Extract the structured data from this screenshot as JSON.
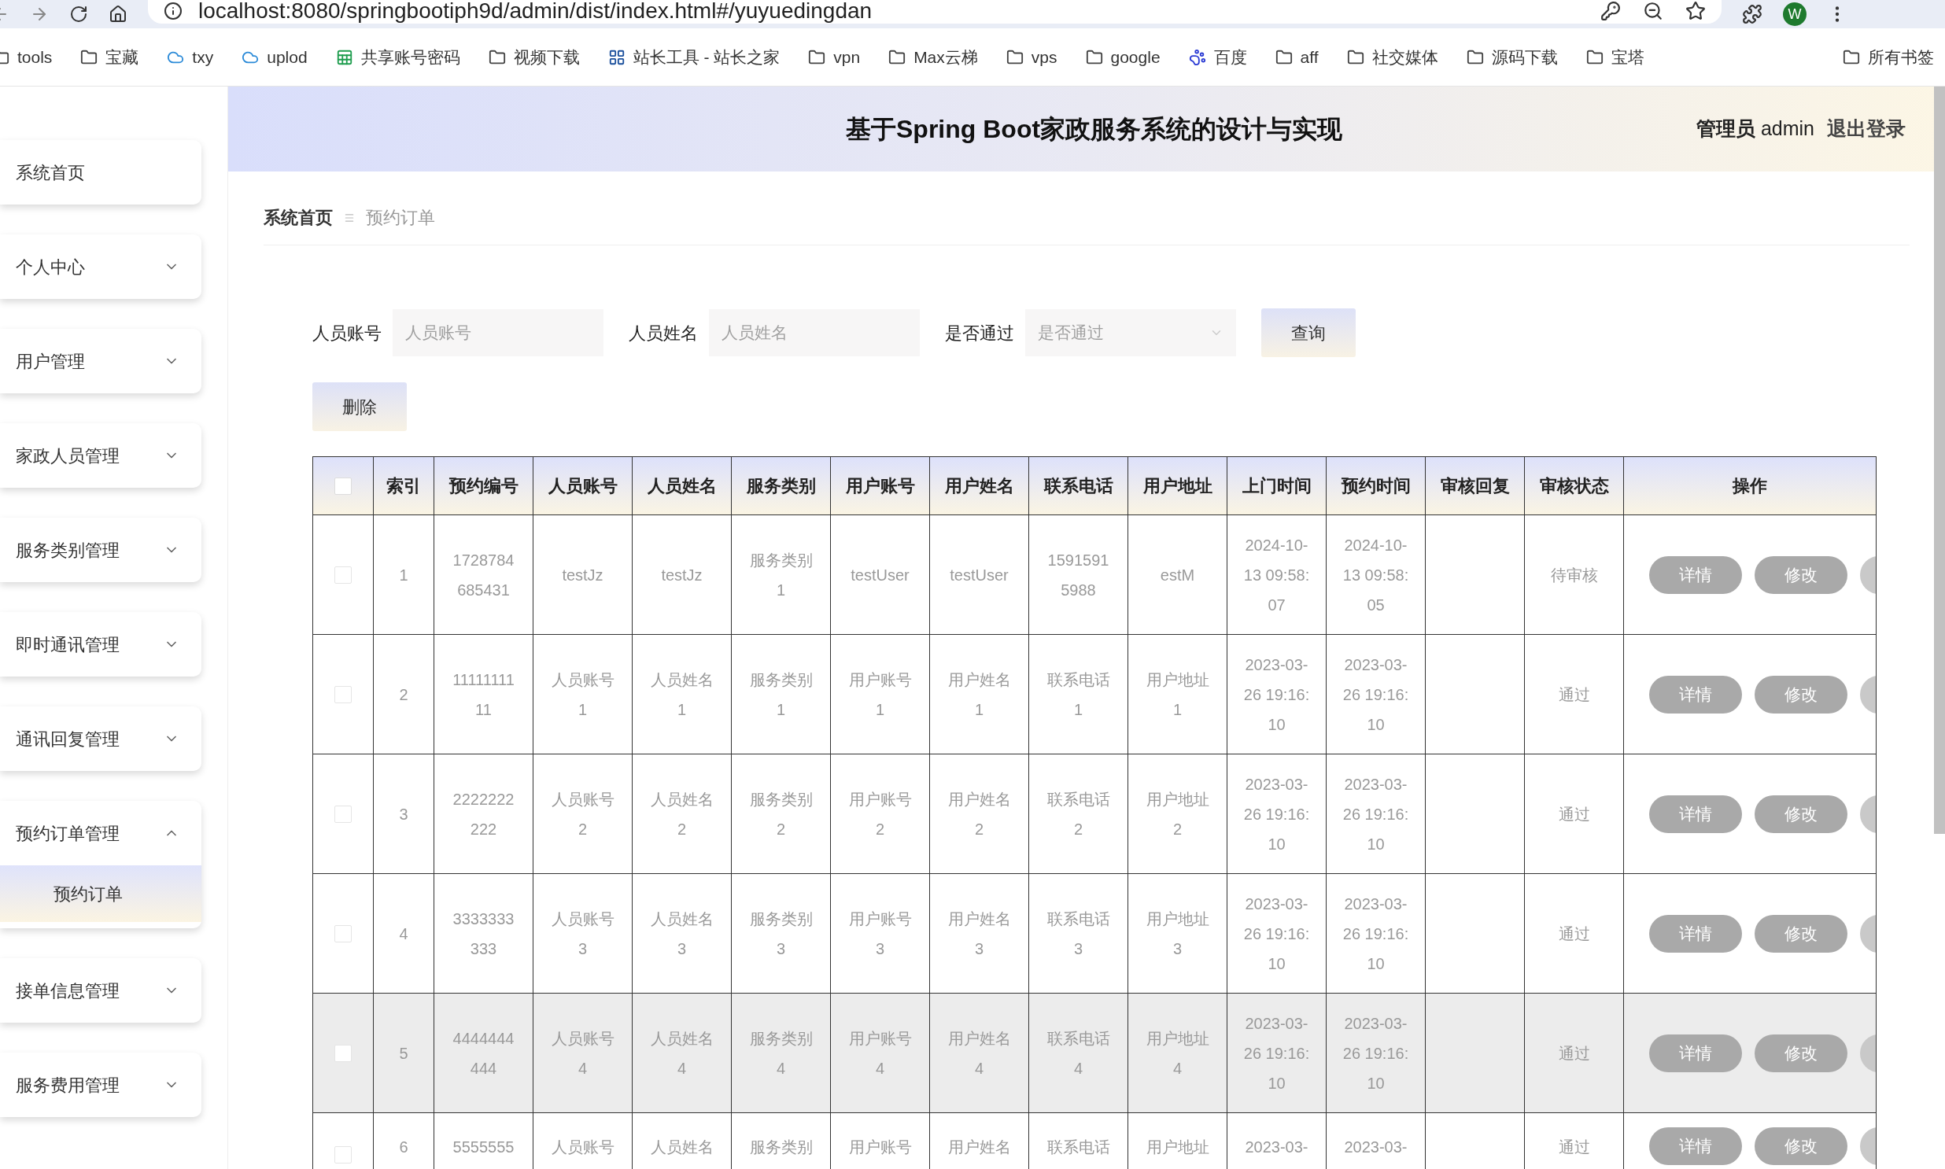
{
  "browser": {
    "url": "localhost:8080/springbootiph9d/admin/dist/index.html#/yuyuedingdan",
    "profile_initial": "W",
    "bookmarks": [
      {
        "label": "tools",
        "kind": "folder"
      },
      {
        "label": "宝藏",
        "kind": "folder"
      },
      {
        "label": "txy",
        "kind": "cloud"
      },
      {
        "label": "uplod",
        "kind": "cloud"
      },
      {
        "label": "共享账号密码",
        "kind": "sheet"
      },
      {
        "label": "视频下载",
        "kind": "folder"
      },
      {
        "label": "站长工具 - 站长之家",
        "kind": "site"
      },
      {
        "label": "vpn",
        "kind": "folder"
      },
      {
        "label": "Max云梯",
        "kind": "folder"
      },
      {
        "label": "vps",
        "kind": "folder"
      },
      {
        "label": "google",
        "kind": "folder"
      },
      {
        "label": "百度",
        "kind": "paw"
      },
      {
        "label": "aff",
        "kind": "folder"
      },
      {
        "label": "社交媒体",
        "kind": "folder"
      },
      {
        "label": "源码下载",
        "kind": "folder"
      },
      {
        "label": "宝塔",
        "kind": "folder"
      },
      {
        "label": "所有书签",
        "kind": "folder"
      }
    ]
  },
  "header": {
    "title": "基于Spring Boot家政服务系统的设计与实现",
    "user_role": "管理员",
    "user_name": "admin",
    "logout": "退出登录"
  },
  "sidebar": {
    "items": [
      {
        "label": "系统首页"
      },
      {
        "label": "个人中心",
        "expanded": false
      },
      {
        "label": "用户管理",
        "expanded": false
      },
      {
        "label": "家政人员管理",
        "expanded": false
      },
      {
        "label": "服务类别管理",
        "expanded": false
      },
      {
        "label": "即时通讯管理",
        "expanded": false
      },
      {
        "label": "通讯回复管理",
        "expanded": false
      },
      {
        "label": "预约订单管理",
        "expanded": true,
        "children": [
          {
            "label": "预约订单",
            "selected": true
          }
        ]
      },
      {
        "label": "接单信息管理",
        "expanded": false
      },
      {
        "label": "服务费用管理",
        "expanded": false
      }
    ]
  },
  "breadcrumb": [
    "系统首页",
    "预约订单"
  ],
  "search": {
    "fields": [
      {
        "label": "人员账号",
        "placeholder": "人员账号",
        "kind": "text"
      },
      {
        "label": "人员姓名",
        "placeholder": "人员姓名",
        "kind": "text"
      },
      {
        "label": "是否通过",
        "placeholder": "是否通过",
        "kind": "select"
      }
    ],
    "button": "查询"
  },
  "delete_button": "删除",
  "table": {
    "header_checked": false,
    "columns": [
      {
        "label": "索引",
        "kind": "index"
      },
      {
        "label": "预约编号",
        "kind": "text"
      },
      {
        "label": "人员账号",
        "kind": "text"
      },
      {
        "label": "人员姓名",
        "kind": "text"
      },
      {
        "label": "服务类别",
        "kind": "text"
      },
      {
        "label": "用户账号",
        "kind": "text"
      },
      {
        "label": "用户姓名",
        "kind": "text"
      },
      {
        "label": "联系电话",
        "kind": "text"
      },
      {
        "label": "用户地址",
        "kind": "text"
      },
      {
        "label": "上门时间",
        "kind": "text"
      },
      {
        "label": "预约时间",
        "kind": "text"
      },
      {
        "label": "审核回复",
        "kind": "blank"
      },
      {
        "label": "审核状态",
        "kind": "text"
      },
      {
        "label": "操作",
        "kind": "actions"
      }
    ],
    "rows": [
      {
        "kind": "full",
        "checked": false,
        "hovered": false,
        "cells": [
          "1",
          "1728784685431",
          "testJz",
          "testJz",
          "服务类别1",
          "testUser",
          "testUser",
          "15915915988",
          "estM",
          "2024-10-13 09:58:07",
          "2024-10-13 09:58:05",
          "待审核"
        ],
        "actions": [
          "详情",
          "修改"
        ]
      },
      {
        "kind": "full",
        "checked": false,
        "hovered": false,
        "cells": [
          "2",
          "1111111111",
          "人员账号1",
          "人员姓名1",
          "服务类别1",
          "用户账号1",
          "用户姓名1",
          "联系电话1",
          "用户地址1",
          "2023-03-26 19:16:10",
          "2023-03-26 19:16:10",
          "通过"
        ],
        "actions": [
          "详情",
          "修改"
        ]
      },
      {
        "kind": "full",
        "checked": false,
        "hovered": false,
        "cells": [
          "3",
          "2222222222",
          "人员账号2",
          "人员姓名2",
          "服务类别2",
          "用户账号2",
          "用户姓名2",
          "联系电话2",
          "用户地址2",
          "2023-03-26 19:16:10",
          "2023-03-26 19:16:10",
          "通过"
        ],
        "actions": [
          "详情",
          "修改"
        ]
      },
      {
        "kind": "full",
        "checked": false,
        "hovered": false,
        "cells": [
          "4",
          "3333333333",
          "人员账号3",
          "人员姓名3",
          "服务类别3",
          "用户账号3",
          "用户姓名3",
          "联系电话3",
          "用户地址3",
          "2023-03-26 19:16:10",
          "2023-03-26 19:16:10",
          "通过"
        ],
        "actions": [
          "详情",
          "修改"
        ]
      },
      {
        "kind": "full",
        "checked": false,
        "hovered": true,
        "cells": [
          "5",
          "4444444444",
          "人员账号4",
          "人员姓名4",
          "服务类别4",
          "用户账号4",
          "用户姓名4",
          "联系电话4",
          "用户地址4",
          "2023-03-26 19:16:10",
          "2023-03-26 19:16:10",
          "通过"
        ],
        "actions": [
          "详情",
          "修改"
        ]
      },
      {
        "kind": "partial",
        "checked": false,
        "hovered": false,
        "cells": [
          "6",
          "5555555",
          "人员账号",
          "人员姓名",
          "服务类别",
          "用户账号",
          "用户姓名",
          "联系电话",
          "用户地址",
          "2023-03-",
          "2023-03-",
          "通过"
        ],
        "actions": [
          "详情",
          "修改"
        ]
      }
    ]
  }
}
